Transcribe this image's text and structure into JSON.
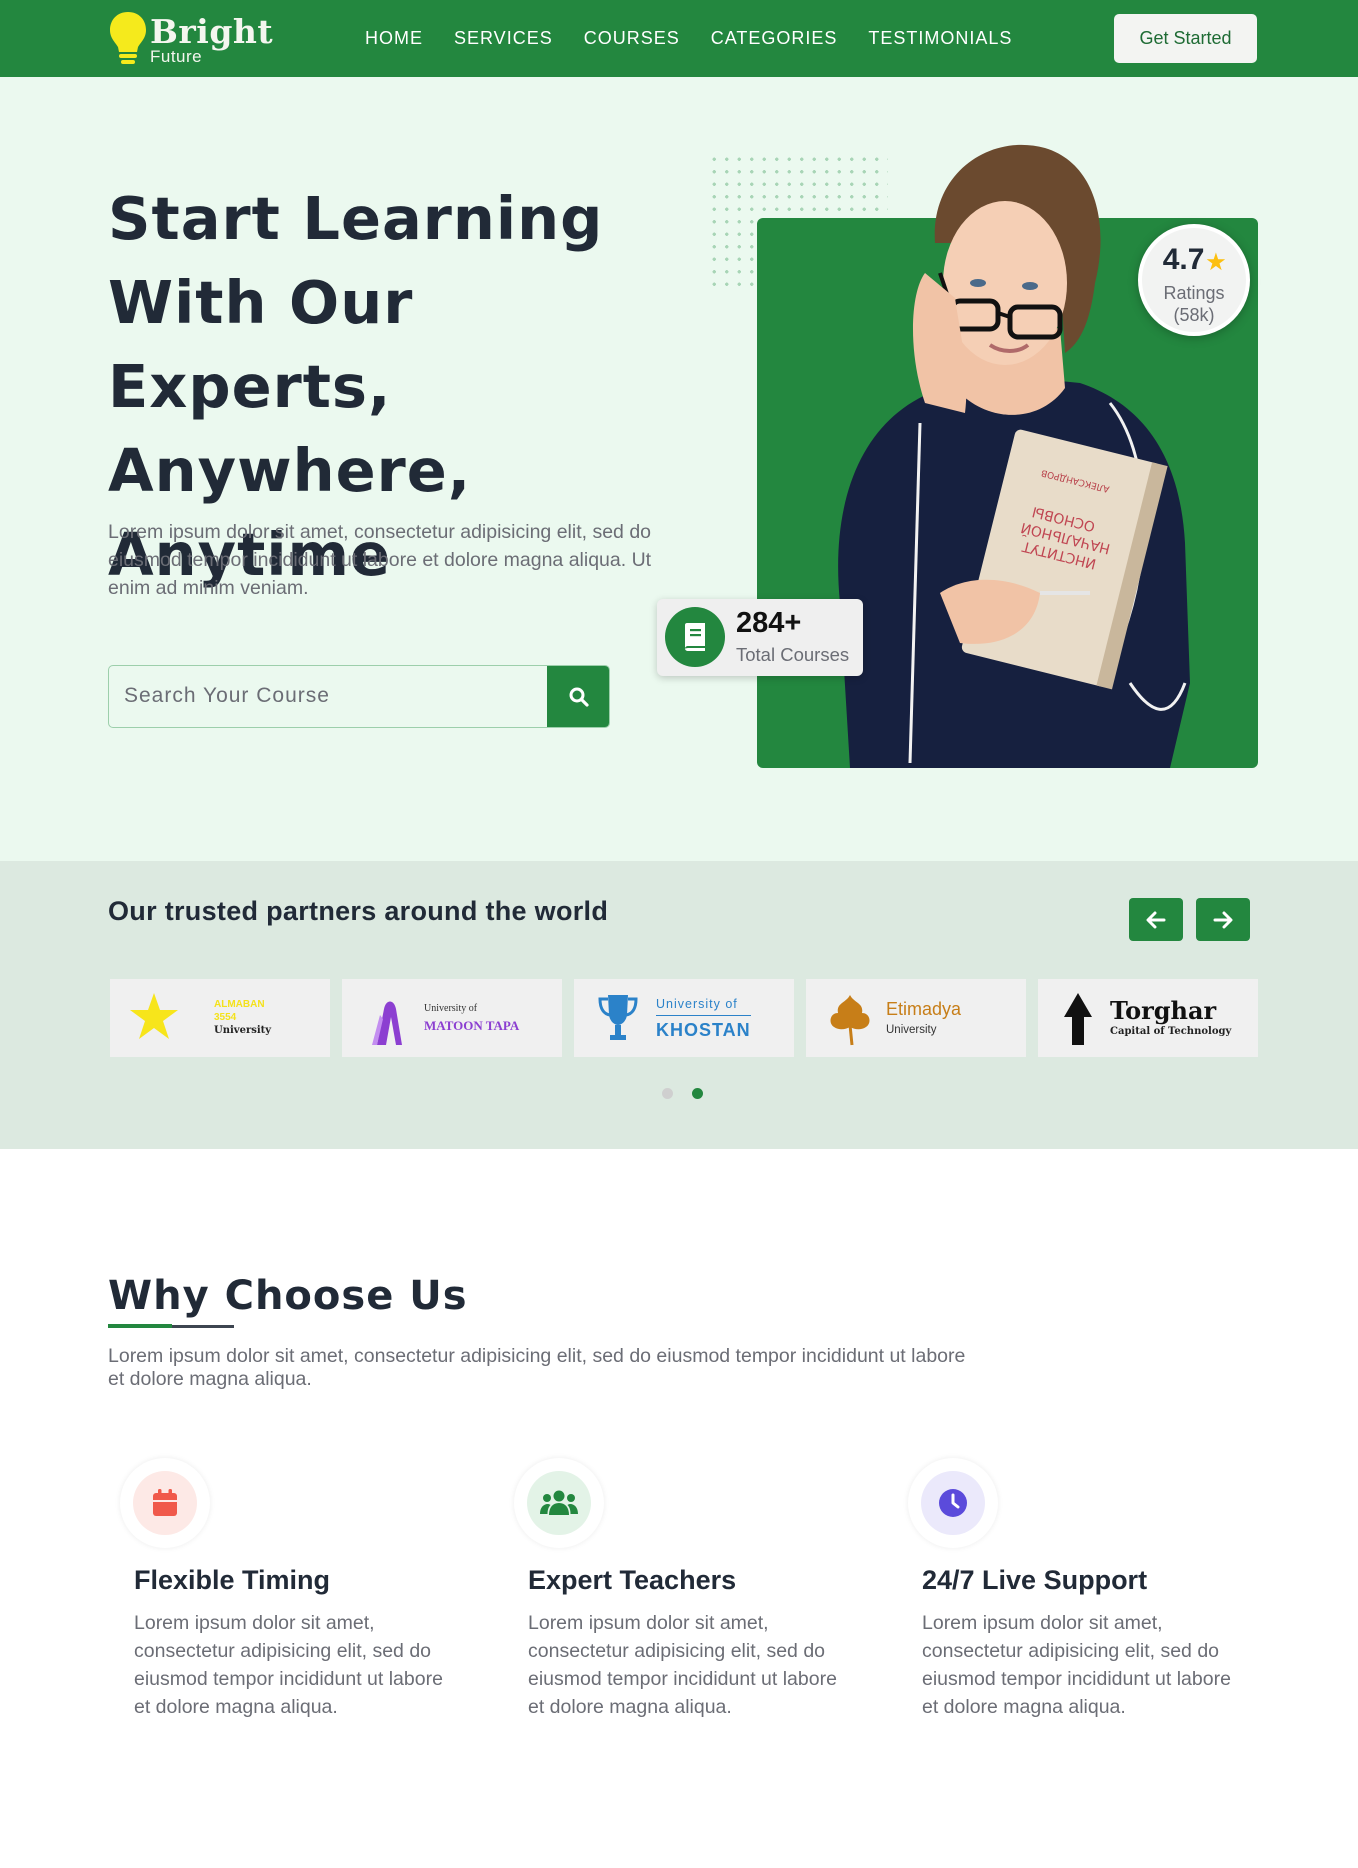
{
  "brand": {
    "name": "Bright",
    "tagline": "Future"
  },
  "nav": {
    "links": [
      "HOME",
      "SERVICES",
      "COURSES",
      "CATEGORIES",
      "TESTIMONIALS"
    ],
    "cta": "Get Started"
  },
  "hero": {
    "title_lines": [
      "Start Learning",
      "With Our Experts,",
      "Anywhere,",
      "Anytime"
    ],
    "description": "Lorem ipsum dolor sit amet, consectetur adipisicing elit, sed do eiusmod tempor incididunt ut labore et dolore magna aliqua. Ut enim ad minim veniam.",
    "search_placeholder": "Search Your Course",
    "rating": {
      "value": "4.7",
      "label_line1": "Ratings",
      "label_line2": "(58k)"
    },
    "courses": {
      "count": "284+",
      "label": "Total Courses"
    },
    "book_text": [
      "АЛЕКСАНДРОВ",
      "ОСНОВЫ",
      "НАЧАЛЬНОЙ",
      "ИНСТИТУТ"
    ]
  },
  "partners": {
    "title": "Our trusted partners around the world",
    "logos": [
      {
        "name_line1": "ALMABAN",
        "name_line2": "3554",
        "name_line3": "University"
      },
      {
        "pre": "University of",
        "name": "MATOON TAPA"
      },
      {
        "pre": "University of",
        "name": "KHOSTAN"
      },
      {
        "name": "Etimadya",
        "sub": "University"
      },
      {
        "name": "Torghar",
        "sub": "Capital of Technology"
      }
    ],
    "active_page": 2,
    "pages": 2
  },
  "why": {
    "title": "Why Choose Us",
    "description": "Lorem ipsum dolor sit amet, consectetur adipisicing elit, sed do eiusmod tempor incididunt ut labore et dolore magna aliqua.",
    "features": [
      {
        "icon": "calendar-icon",
        "title": "Flexible Timing",
        "description": "Lorem ipsum dolor sit amet, consectetur adipisicing elit, sed do eiusmod tempor incididunt ut labore et dolore magna aliqua."
      },
      {
        "icon": "users-icon",
        "title": "Expert Teachers",
        "description": "Lorem ipsum dolor sit amet, consectetur adipisicing elit, sed do eiusmod tempor incididunt ut labore et dolore magna aliqua."
      },
      {
        "icon": "clock-icon",
        "title": "24/7 Live Support",
        "description": "Lorem ipsum dolor sit amet, consectetur adipisicing elit, sed do eiusmod tempor incididunt ut labore et dolore magna aliqua."
      }
    ]
  },
  "colors": {
    "brand_green": "#23873f",
    "hero_bg": "#ebf9ef",
    "partners_bg": "#dce9e0",
    "star": "#fcbf0f",
    "calendar_accent": "#f0594b",
    "users_accent": "#23873f",
    "clock_accent": "#5b4bdb"
  }
}
